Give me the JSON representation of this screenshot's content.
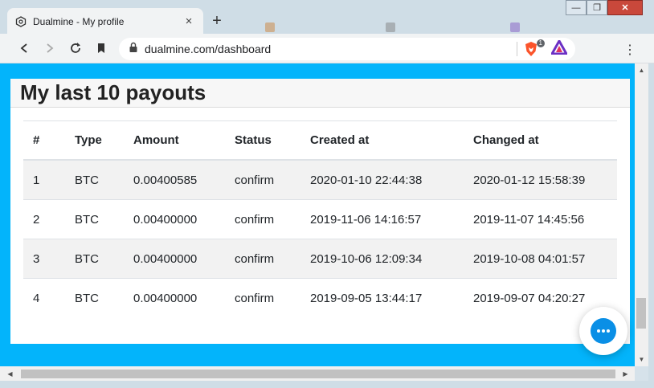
{
  "browser": {
    "tab_title": "Dualmine - My profile",
    "tab_close": "×",
    "new_tab": "+",
    "url": "dualmine.com/dashboard",
    "brave_badge": "1",
    "menu_icon": "⋮",
    "window_controls": {
      "minimize": "—",
      "restore": "❐",
      "close": "✕"
    }
  },
  "page": {
    "title": "My last 10 payouts",
    "table": {
      "headers": [
        "#",
        "Type",
        "Amount",
        "Status",
        "Created at",
        "Changed at"
      ],
      "rows": [
        [
          "1",
          "BTC",
          "0.00400585",
          "confirm",
          "2020-01-10 22:44:38",
          "2020-01-12 15:58:39"
        ],
        [
          "2",
          "BTC",
          "0.00400000",
          "confirm",
          "2019-11-06 14:16:57",
          "2019-11-07 14:45:56"
        ],
        [
          "3",
          "BTC",
          "0.00400000",
          "confirm",
          "2019-10-06 12:09:34",
          "2019-10-08 04:01:57"
        ],
        [
          "4",
          "BTC",
          "0.00400000",
          "confirm",
          "2019-09-05 13:44:17",
          "2019-09-07 04:20:27"
        ]
      ]
    }
  },
  "colors": {
    "accent": "#03b4fb",
    "chat": "#0a8fe6",
    "brave": "#fb542b"
  },
  "icons": [
    "hexagon-favicon",
    "back-icon",
    "forward-icon",
    "reload-icon",
    "bookmark-icon",
    "lock-icon",
    "brave-shield-icon",
    "brave-rewards-icon",
    "chat-icon"
  ]
}
